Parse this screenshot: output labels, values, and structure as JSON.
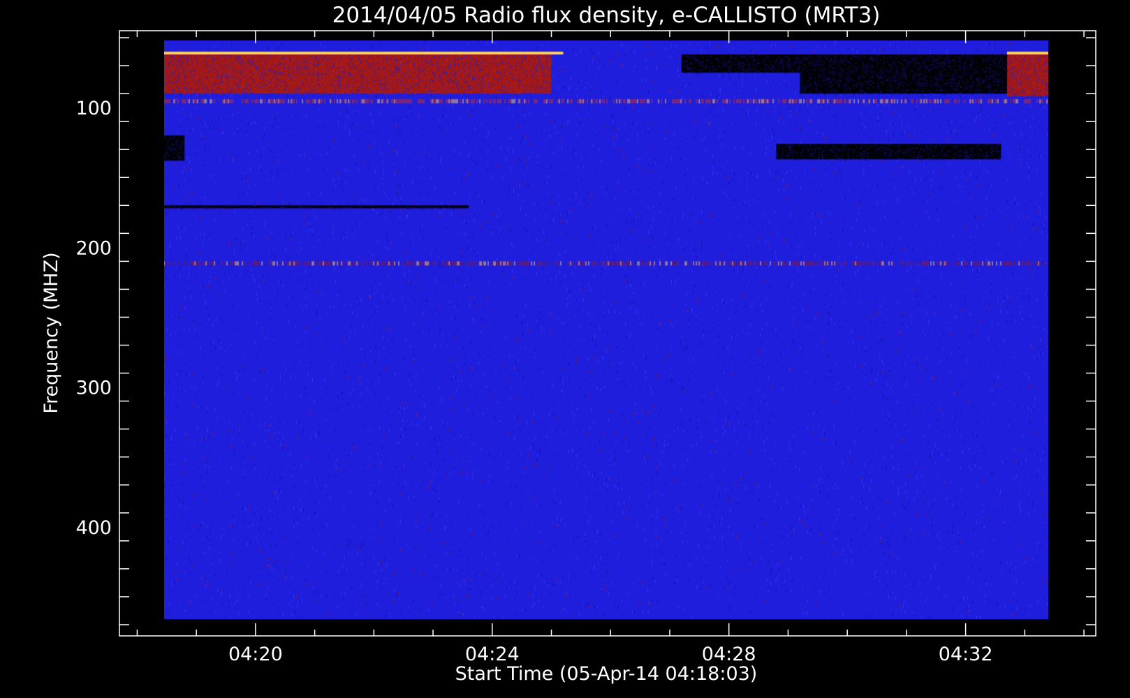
{
  "chart_data": {
    "type": "heatmap",
    "title": "2014/04/05  Radio flux density, e-CALLISTO (MRT3)",
    "xlabel": "Start Time (05-Apr-14 04:18:03)",
    "ylabel": "Frequency (MHZ)",
    "x_ticks": [
      "04:20",
      "04:24",
      "04:28",
      "04:32"
    ],
    "x_tick_minutes": [
      2,
      6,
      10,
      14
    ],
    "y_ticks": [
      100,
      200,
      300,
      400
    ],
    "xlim_minutes": [
      -0.3,
      16.2
    ],
    "ylim": [
      45,
      478
    ],
    "data_extent": {
      "t_start_min": 0.45,
      "t_end_min": 15.4,
      "f_min": 52,
      "f_max": 466
    },
    "colormap": [
      "#000000",
      "#1010c8",
      "#2a2aff",
      "#a01818",
      "#e03010",
      "#ffd060"
    ],
    "background_color": "#1e1edc",
    "features": [
      {
        "kind": "bright",
        "t0": 0.45,
        "t1": 7.2,
        "f0": 60,
        "f1": 62,
        "level": 5
      },
      {
        "kind": "hot",
        "t0": 0.45,
        "t1": 7.0,
        "f0": 62,
        "f1": 90,
        "level": 3
      },
      {
        "kind": "bright",
        "t0": 14.7,
        "t1": 15.4,
        "f0": 60,
        "f1": 62,
        "level": 5
      },
      {
        "kind": "hot",
        "t0": 14.7,
        "t1": 15.4,
        "f0": 62,
        "f1": 92,
        "level": 3
      },
      {
        "kind": "dark",
        "t0": 9.2,
        "t1": 14.7,
        "f0": 62,
        "f1": 75,
        "level": 0
      },
      {
        "kind": "dark",
        "t0": 11.2,
        "t1": 14.7,
        "f0": 75,
        "f1": 90,
        "level": 0
      },
      {
        "kind": "dark",
        "t0": 0.45,
        "t1": 0.8,
        "f0": 120,
        "f1": 138,
        "level": 0
      },
      {
        "kind": "dark",
        "t0": 10.8,
        "t1": 14.6,
        "f0": 126,
        "f1": 137,
        "level": 0
      },
      {
        "kind": "dark",
        "t0": 0.45,
        "t1": 5.6,
        "f0": 170,
        "f1": 172,
        "level": 0
      },
      {
        "kind": "hotline",
        "t0": 0.45,
        "t1": 15.4,
        "f0": 94,
        "f1": 96,
        "level": 4
      },
      {
        "kind": "hotline",
        "t0": 0.45,
        "t1": 15.4,
        "f0": 210,
        "f1": 212,
        "level": 3
      }
    ]
  }
}
